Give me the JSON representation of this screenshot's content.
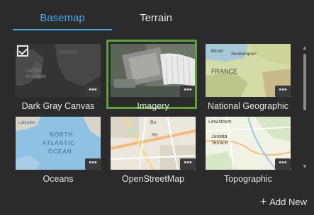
{
  "tabs": [
    {
      "label": "Basemap"
    },
    {
      "label": "Terrain"
    }
  ],
  "basemaps": [
    {
      "label": "Dark Gray Canvas",
      "checked": true
    },
    {
      "label": "Imagery",
      "selected": true
    },
    {
      "label": "National Geographic"
    },
    {
      "label": "Oceans"
    },
    {
      "label": "OpenStreetMap"
    },
    {
      "label": "Topographic"
    }
  ],
  "more_label": "•••",
  "map_text": {
    "dark": [
      "NORWAY",
      "UNITED",
      "KINGDOM"
    ],
    "natgeo": [
      "Bristol",
      "Southampton",
      "FRANCE"
    ],
    "oceans": [
      "Labrador",
      "NORTH",
      "ATLANTIC",
      "OCEAN"
    ],
    "osm": [
      "Bo",
      "Re"
    ],
    "topo": [
      "Lewistown",
      "Juniata",
      "Terrace"
    ]
  },
  "add_new": "Add New",
  "colors": {
    "accent": "#4aa8e9",
    "selected_border": "#5aa33a",
    "panel_bg": "#2b2b2b"
  }
}
